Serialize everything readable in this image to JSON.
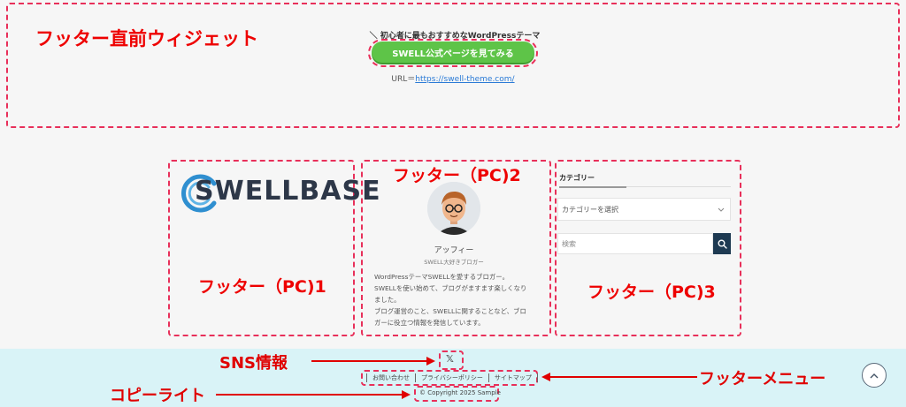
{
  "annotations": {
    "pre_footer": "フッター直前ウィジェット",
    "footer_pc1": "フッター（PC)1",
    "footer_pc2": "フッター（PC)2",
    "footer_pc3": "フッター（PC)3",
    "sns": "SNS情報",
    "copyright": "コピーライト",
    "footer_menu": "フッターメニュー"
  },
  "pre_footer_widget": {
    "tagline": "＼ 初心者に最もおすすめなWordPressテーマ ／",
    "button_label": "SWELL公式ページを見てみる",
    "url_prefix": "URL＝",
    "url_link": "https://swell-theme.com/"
  },
  "footer_pc1": {
    "logo": "SWELLBASE"
  },
  "footer_pc2": {
    "name": "アッフィー",
    "subtitle": "SWELL大好きブロガー",
    "bio": [
      "WordPressテーマSWELLを愛するブロガー。",
      "SWELLを使い始めて、ブログがますます楽しくなり",
      "ました。",
      "ブログ運営のこと、SWELLに関することなど、ブロ",
      "ガーに役立つ情報を発信しています。"
    ]
  },
  "footer_pc3": {
    "category_title": "カテゴリー",
    "select_placeholder": "カテゴリーを選択",
    "search_placeholder": "検索"
  },
  "footer_bottom": {
    "sns_icon": "x-icon",
    "sns_glyph": "𝕏",
    "menu": [
      "お問い合わせ",
      "プライバシーポリシー",
      "サイトマップ"
    ],
    "copyright": "© Copyright 2025 Sample"
  },
  "colors": {
    "annotation_red": "#e8305a",
    "button_green": "#5ec448",
    "footer_bg": "#d9f3f7",
    "search_button": "#1e3a52"
  }
}
